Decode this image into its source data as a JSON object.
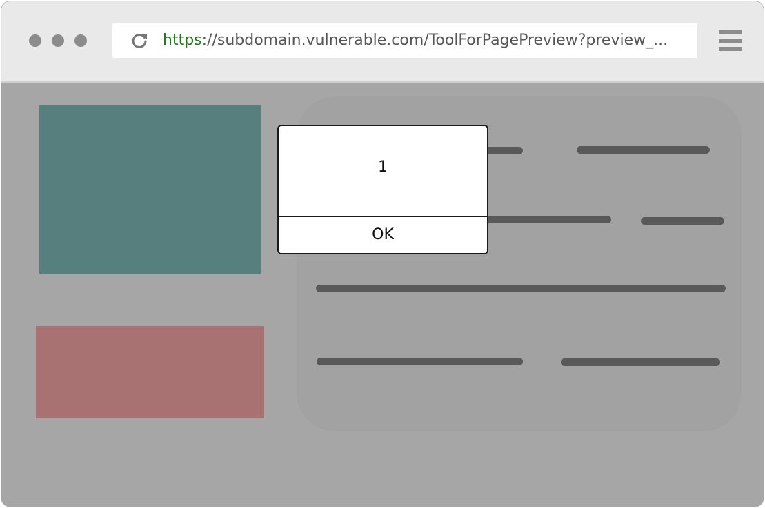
{
  "browser": {
    "window_controls": [
      "dot",
      "dot",
      "dot"
    ],
    "address_bar": {
      "scheme": "https",
      "rest": "://subdomain.vulnerable.com/ToolForPagePreview?preview_..."
    },
    "reload_icon": "reload-icon",
    "menu_icon": "hamburger-menu-icon"
  },
  "page": {
    "placeholder_colors": {
      "teal_block": "#577f7d",
      "rose_block": "#a97272"
    }
  },
  "alert_dialog": {
    "message": "1",
    "ok_label": "OK"
  }
}
